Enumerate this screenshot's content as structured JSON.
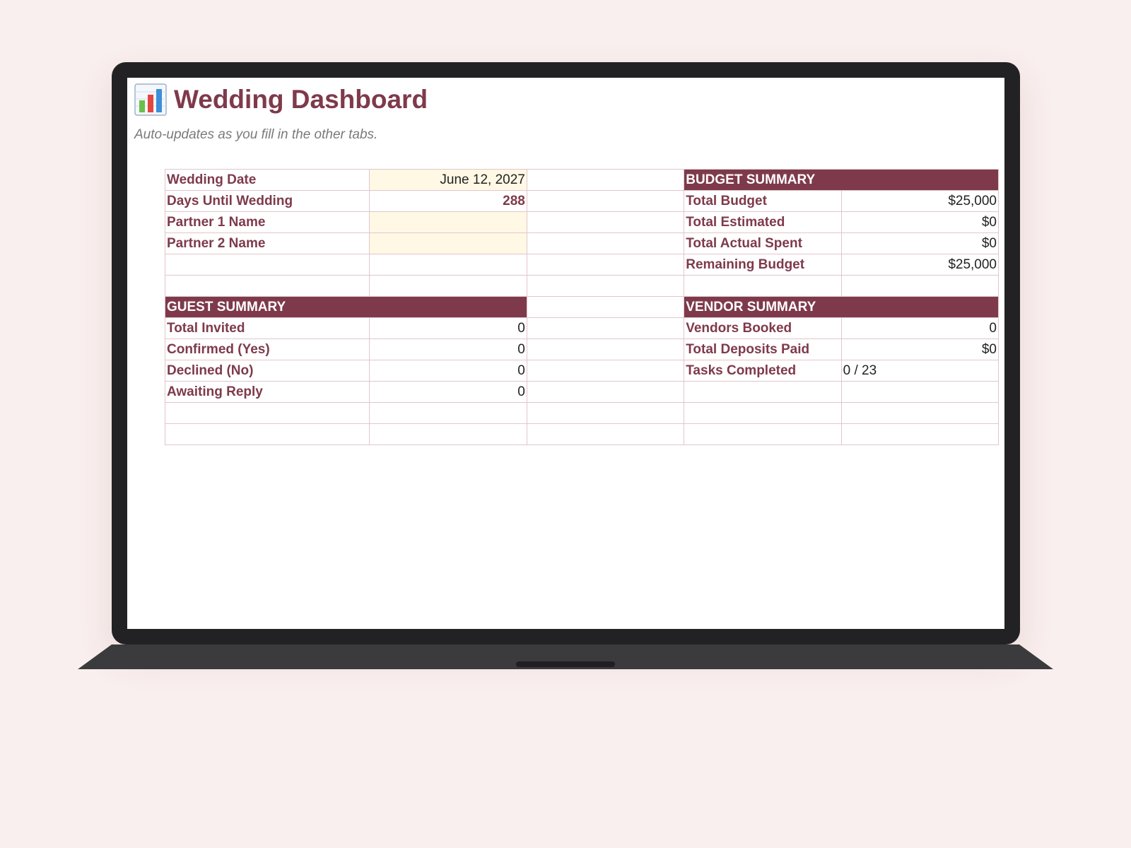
{
  "dashboard": {
    "icon": "bar-chart-icon",
    "title": "Wedding Dashboard",
    "subtitle": "Auto-updates as you fill in the other tabs."
  },
  "info": {
    "wedding_date_label": "Wedding Date",
    "wedding_date_value": "June 12, 2027",
    "days_until_label": "Days Until Wedding",
    "days_until_value": "288",
    "partner1_label": "Partner 1 Name",
    "partner1_value": "",
    "partner2_label": "Partner 2 Name",
    "partner2_value": ""
  },
  "budget_summary": {
    "header": "BUDGET SUMMARY",
    "rows": [
      {
        "label": "Total Budget",
        "value": "$25,000"
      },
      {
        "label": "Total Estimated",
        "value": "$0"
      },
      {
        "label": "Total Actual Spent",
        "value": "$0"
      },
      {
        "label": "Remaining Budget",
        "value": "$25,000"
      }
    ]
  },
  "guest_summary": {
    "header": "GUEST SUMMARY",
    "rows": [
      {
        "label": "Total Invited",
        "value": "0"
      },
      {
        "label": "Confirmed (Yes)",
        "value": "0"
      },
      {
        "label": "Declined (No)",
        "value": "0"
      },
      {
        "label": "Awaiting Reply",
        "value": "0"
      }
    ]
  },
  "vendor_summary": {
    "header": "VENDOR SUMMARY",
    "rows": [
      {
        "label": "Vendors Booked",
        "value": "0"
      },
      {
        "label": "Total Deposits Paid",
        "value": "$0"
      },
      {
        "label": "Tasks Completed",
        "value": "0 / 23"
      }
    ]
  },
  "colors": {
    "accent": "#7e3a4b",
    "input_fill": "#fff8e5",
    "grid_line": "#e2c6cb",
    "background": "#f9efee"
  }
}
